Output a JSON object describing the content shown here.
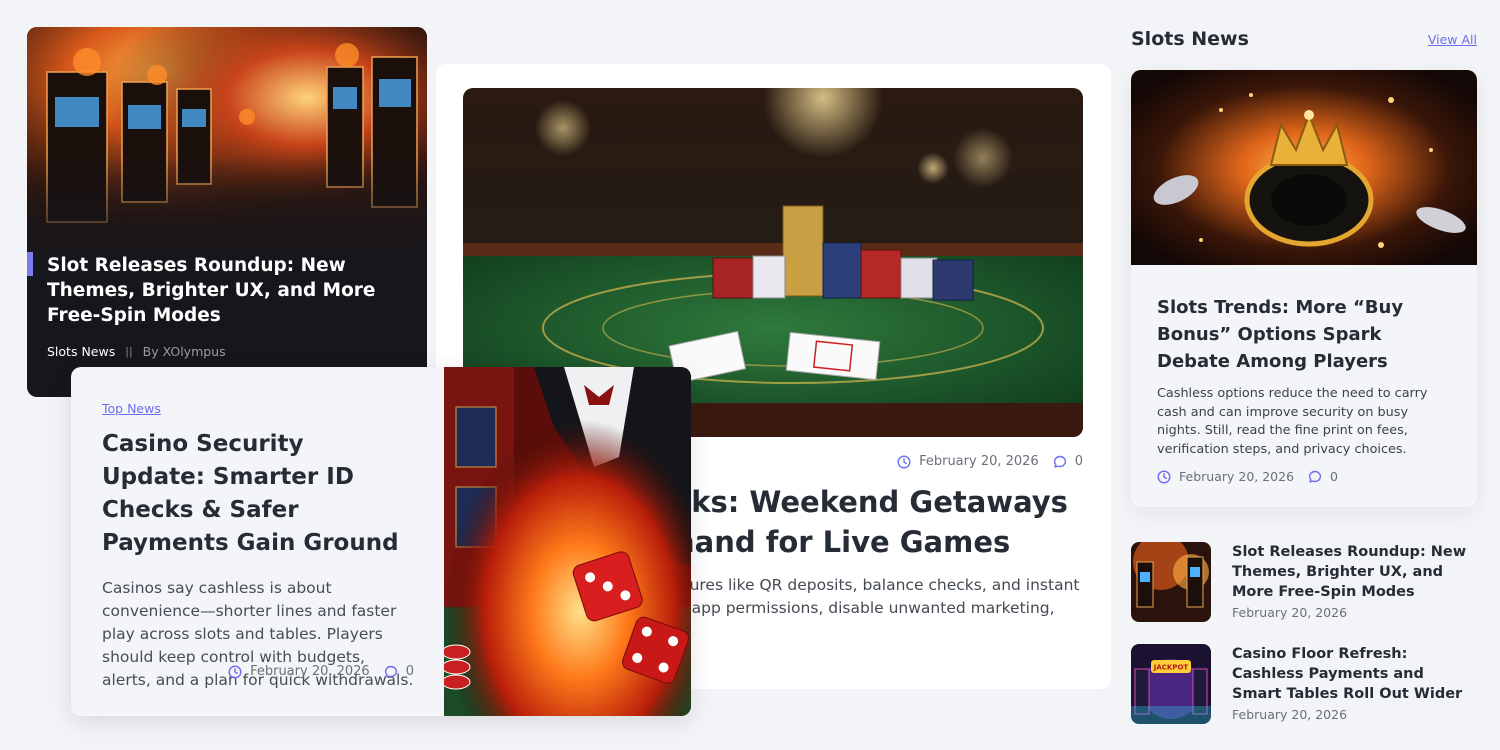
{
  "overlay_card": {
    "title": "Slot Releases Roundup: New Themes, Brighter UX, and More Free-Spin Modes",
    "category": "Slots News",
    "author": "By XOlympus",
    "separator": "||"
  },
  "featured": {
    "date": "February 20, 2026",
    "comments": "0",
    "headline_line1": "cks: Weekend Getaways",
    "headline_line2": "nand for Live Games",
    "excerpt_line1": "atures like QR deposits, balance checks, and instant",
    "excerpt_line2": "w app permissions, disable unwanted marketing,"
  },
  "split_card": {
    "category": "Top News",
    "title": "Casino Security Update: Smarter ID Checks & Safer Payments Gain Ground",
    "excerpt": "Casinos say cashless is about convenience—shorter lines and faster play across slots and tables. Players should keep control with budgets, alerts, and a plan for quick withdrawals.",
    "date": "February 20, 2026",
    "comments": "0"
  },
  "sidebar": {
    "title": "Slots News",
    "view_all": "View All",
    "big_card": {
      "title": "Slots Trends: More “Buy Bonus” Options Spark Debate Among Players",
      "excerpt": "Cashless options reduce the need to carry cash and can improve security on busy nights. Still, read the fine print on fees, verification steps, and privacy choices.",
      "date": "February 20, 2026",
      "comments": "0"
    },
    "items": [
      {
        "title": "Slot Releases Roundup: New Themes, Brighter UX, and More Free-Spin Modes",
        "date": "February 20, 2026"
      },
      {
        "title": "Casino Floor Refresh: Cashless Payments and Smart Tables Roll Out Wider",
        "date": "February 20, 2026",
        "thumb_sign": "JACKPOT"
      }
    ]
  },
  "colors": {
    "accent": "#6b6ef0",
    "text_dark": "#262c36",
    "page_bg": "#f3f4f7"
  }
}
